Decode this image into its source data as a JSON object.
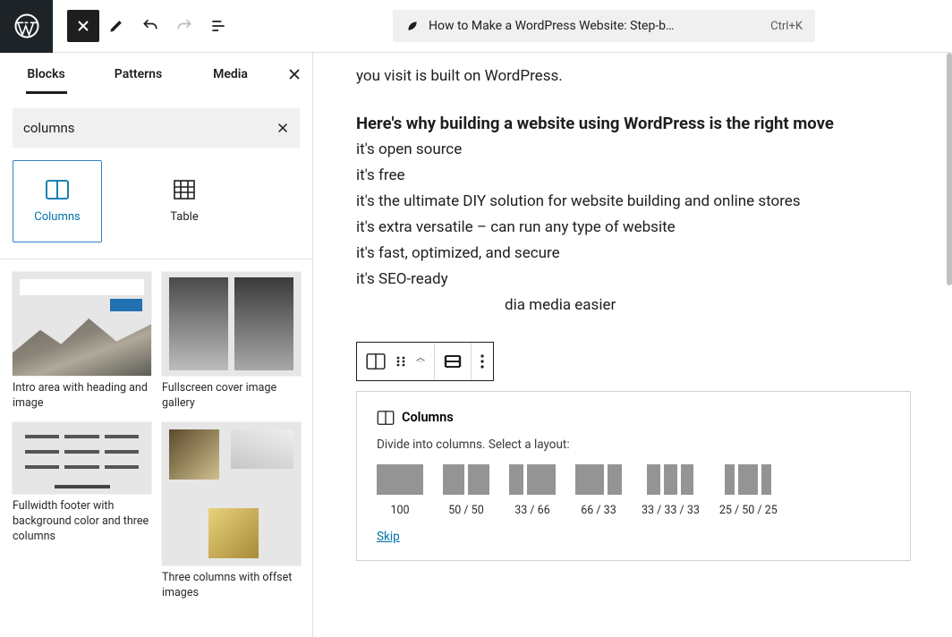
{
  "header": {
    "doc_title": "How to Make a WordPress Website: Step-b…",
    "shortcut": "Ctrl+K"
  },
  "sidebar": {
    "tabs": [
      "Blocks",
      "Patterns",
      "Media"
    ],
    "search_value": "columns",
    "blocks": [
      {
        "label": "Columns"
      },
      {
        "label": "Table"
      }
    ],
    "patterns": [
      {
        "label": "Intro area with heading and image"
      },
      {
        "label": "Fullscreen cover image gallery"
      },
      {
        "label": "Fullwidth footer with background color and three columns"
      },
      {
        "label": "Three columns with offset images"
      }
    ]
  },
  "content": {
    "p1": "you visit is built on WordPress.",
    "h1": "Here's why building a website using WordPress is the right move",
    "lines": [
      "it's open source",
      "it's free",
      "it's the ultimate DIY solution for website building and online stores",
      "it's extra versatile – can run any type of website",
      "it's fast, optimized, and secure",
      "it's SEO-ready",
      "dia media easier"
    ]
  },
  "columns_block": {
    "title": "Columns",
    "hint": "Divide into columns. Select a layout:",
    "layouts": [
      {
        "label": "100",
        "widths": [
          100
        ]
      },
      {
        "label": "50 / 50",
        "widths": [
          50,
          50
        ]
      },
      {
        "label": "33 / 66",
        "widths": [
          33,
          66
        ]
      },
      {
        "label": "66 / 33",
        "widths": [
          66,
          33
        ]
      },
      {
        "label": "33 / 33 / 33",
        "widths": [
          33,
          33,
          33
        ]
      },
      {
        "label": "25 / 50 / 25",
        "widths": [
          25,
          50,
          25
        ]
      }
    ],
    "skip": "Skip"
  }
}
